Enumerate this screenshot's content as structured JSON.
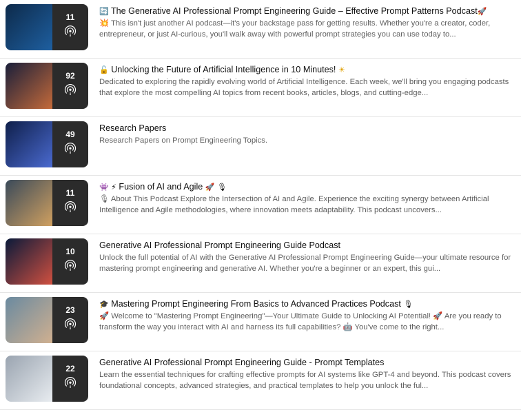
{
  "podcasts": [
    {
      "count": "11",
      "title_prefix": "🔄",
      "title": "The Generative AI Professional Prompt Engineering Guide – Effective Prompt Patterns Podcast",
      "title_suffix": "🚀",
      "description": "💥 This isn't just another AI podcast—it's your backstage pass for getting results. Whether you're a creator, coder, entrepreneur, or just AI-curious, you'll walk away with powerful prompt strategies you can use today to..."
    },
    {
      "count": "92",
      "title_prefix": "🔓",
      "title": "Unlocking the Future of Artificial Intelligence in 10 Minutes!",
      "title_suffix": "☀",
      "description": "Dedicated to exploring the rapidly evolving world of Artificial Intelligence. Each week, we'll bring you engaging podcasts that explore the most compelling AI topics from recent books, articles, blogs, and cutting-edge..."
    },
    {
      "count": "49",
      "title_prefix": "",
      "title": "Research Papers",
      "title_suffix": "",
      "description": "Research Papers on Prompt Engineering Topics."
    },
    {
      "count": "11",
      "title_prefix": "👾 ⚡",
      "title": "Fusion of AI and Agile",
      "title_suffix": "🚀 🎙",
      "description": "🎙 About This Podcast Explore the Intersection of AI and Agile. Experience the exciting synergy between Artificial Intelligence and Agile methodologies, where innovation meets adaptability. This podcast uncovers..."
    },
    {
      "count": "10",
      "title_prefix": "",
      "title": "Generative AI Professional Prompt Engineering Guide Podcast",
      "title_suffix": "",
      "description": "Unlock the full potential of AI with the Generative AI Professional Prompt Engineering Guide—your ultimate resource for mastering prompt engineering and generative AI. Whether you're a beginner or an expert, this gui..."
    },
    {
      "count": "23",
      "title_prefix": "🎓",
      "title": "Mastering Prompt Engineering From Basics to Advanced Practices Podcast",
      "title_suffix": "🎙",
      "description": "🚀 Welcome to \"Mastering Prompt Engineering\"—Your Ultimate Guide to Unlocking AI Potential! 🚀 Are you ready to transform the way you interact with AI and harness its full capabilities? 🤖 You've come to the right..."
    },
    {
      "count": "22",
      "title_prefix": "",
      "title": "Generative AI Professional Prompt Engineering Guide - Prompt Templates",
      "title_suffix": "",
      "description": "Learn the essential techniques for crafting effective prompts for AI systems like GPT-4 and beyond. This podcast covers foundational concepts, advanced strategies, and practical templates to help you unlock the ful..."
    }
  ],
  "thumbnail_colors": [
    [
      "#0d2a4a",
      "#1e5fa0"
    ],
    [
      "#1a1f3a",
      "#c46a3a"
    ],
    [
      "#0f1f4a",
      "#4a6ad0"
    ],
    [
      "#3a4a5a",
      "#d0a060"
    ],
    [
      "#0a1a3a",
      "#d05040"
    ],
    [
      "#6a8aa0",
      "#d0b090"
    ],
    [
      "#9aa4b0",
      "#e8ecf0"
    ]
  ]
}
